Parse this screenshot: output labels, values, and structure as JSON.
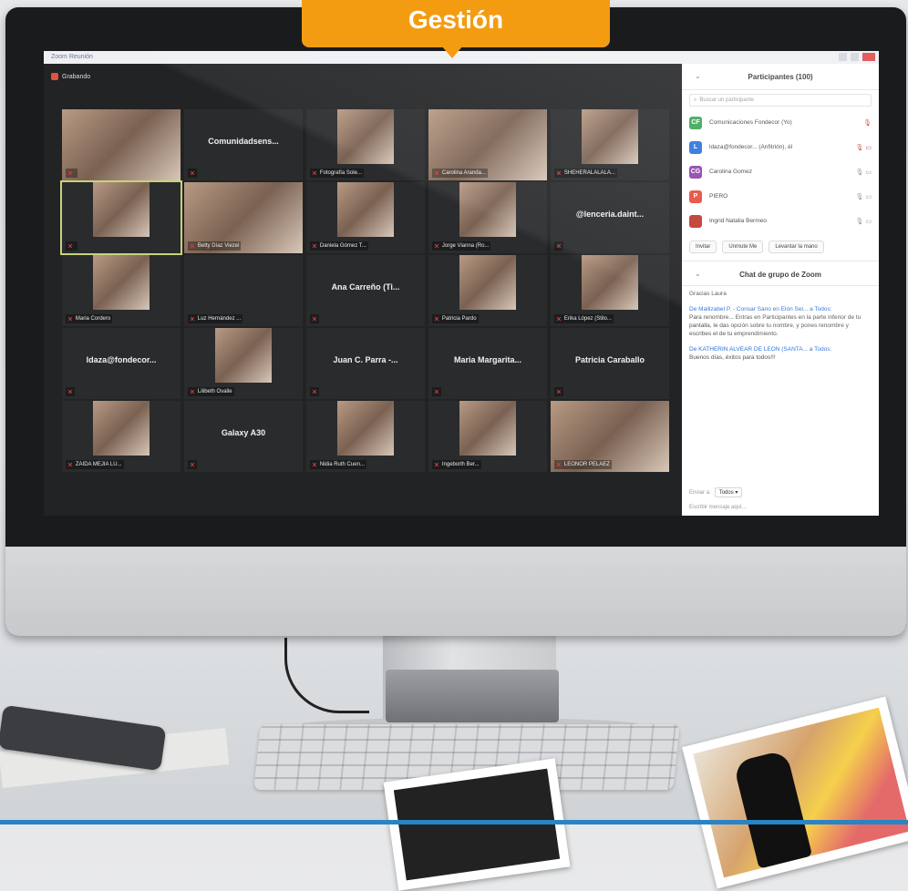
{
  "banner": {
    "label": "Gestión"
  },
  "window": {
    "app_title": "Zoom Reunión"
  },
  "recording": {
    "label": "Grabando"
  },
  "tiles": [
    {
      "name": "",
      "type": "video"
    },
    {
      "name": "Comunidadsens...",
      "type": "name"
    },
    {
      "name": "Fotografía Sole...",
      "type": "video"
    },
    {
      "name": "Carolina Aranda...",
      "type": "video"
    },
    {
      "name": "SHEHERALALALA...",
      "type": "video"
    },
    {
      "name": "",
      "type": "video"
    },
    {
      "name": "Betty Díaz Viezel",
      "type": "video"
    },
    {
      "name": "Daniela Gómez T...",
      "type": "video"
    },
    {
      "name": "Jorge Vianna (Ro...",
      "type": "video"
    },
    {
      "name": "@lenceria.daint...",
      "type": "name"
    },
    {
      "name": "Maria Cordero",
      "type": "video"
    },
    {
      "name": "Luz Hernández ...",
      "type": "blank"
    },
    {
      "name": "Ana Carreño (Ti...",
      "type": "name"
    },
    {
      "name": "Patricia Pardo",
      "type": "video"
    },
    {
      "name": "Erika López (Stilo...",
      "type": "video"
    },
    {
      "name": "ldaza@fondecor...",
      "type": "name"
    },
    {
      "name": "Lilibeth Ovalle",
      "type": "video"
    },
    {
      "name": "Juan C. Parra -...",
      "type": "name"
    },
    {
      "name": "Maria Margarita...",
      "type": "name"
    },
    {
      "name": "Patricia Caraballo",
      "type": "name"
    },
    {
      "name": "ZAIDA MEJIA LU...",
      "type": "video"
    },
    {
      "name": "Galaxy A30",
      "type": "name"
    },
    {
      "name": "Nidia Ruth Cuen...",
      "type": "video"
    },
    {
      "name": "Ingeborlh Ber...",
      "type": "video"
    },
    {
      "name": "LEONOR PELAEZ",
      "type": "video"
    }
  ],
  "participants": {
    "title": "Participantes (100)",
    "search_placeholder": "Buscar un participante",
    "rows": [
      {
        "initials": "CF",
        "color": "#3aa757",
        "name": "Comunicaciones Fondecor (Yo)",
        "icons": "🎙"
      },
      {
        "initials": "L",
        "color": "#2d72d9",
        "name": "ldaza@fondecor... (Anfitrión), él",
        "icons": "🎙 ▭"
      },
      {
        "initials": "CG",
        "color": "#8e44ad",
        "name": "Carolina Gomez",
        "icons": "🎙 ▭"
      },
      {
        "initials": "P",
        "color": "#e74c3c",
        "name": "PIERO",
        "icons": "🎙 ▭"
      },
      {
        "initials": "",
        "color": "#c0392b",
        "name": "Ingrid Natalia Bermeo",
        "icons": "🎙 ▭"
      }
    ],
    "buttons": [
      "Invitar",
      "Unmute Me",
      "Levantar la mano"
    ]
  },
  "chat": {
    "title": "Chat de grupo de Zoom",
    "messages": [
      {
        "from": "",
        "text": "Gracias Laura"
      },
      {
        "from": "De Mallizabel P. - Consar Sano en Elón Sel... a Todos:",
        "text": "Para renombre... Entras en Participantes en la parte inferior de tu pantalla, le das opción sobre tu nombre, y pones renombre y escribes el de tu emprendimiento."
      },
      {
        "from": "De KATHERIN ALVEAR DE LEON (SANTA... a Todos:",
        "text": "Buenos días, éxitos para todos!!!"
      }
    ],
    "send_to_label": "Enviar a:",
    "send_to_value": "Todos ▾",
    "input_placeholder": "Escribir mensaje aquí..."
  }
}
